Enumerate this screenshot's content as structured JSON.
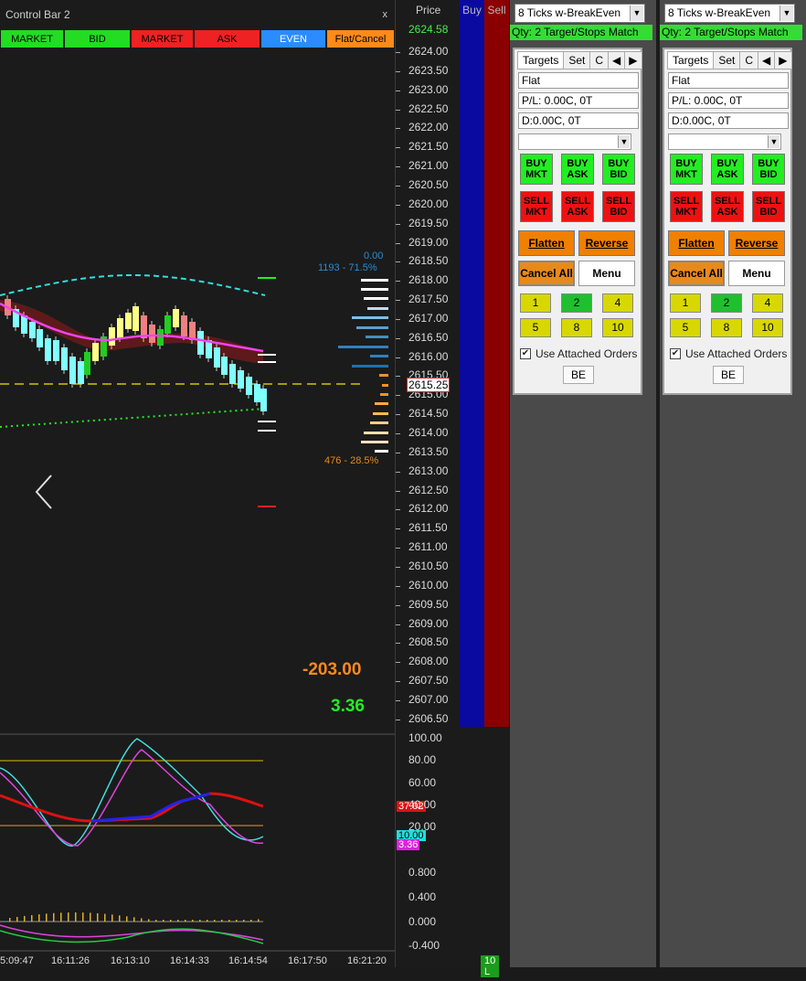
{
  "control_bar": {
    "title": "Control Bar 2",
    "close": "x",
    "buttons": [
      {
        "label": "MARKET",
        "color": "#22dd22",
        "text_color": "#000000"
      },
      {
        "label": "BID",
        "color": "#22dd22",
        "text_color": "#000000"
      },
      {
        "label": "MARKET",
        "color": "#ee2222",
        "text_color": "#000000"
      },
      {
        "label": "ASK",
        "color": "#ee2222",
        "text_color": "#000000"
      },
      {
        "label": "EVEN",
        "color": "#2a8cff",
        "text_color": "#ffffff"
      },
      {
        "label": "Flat/Cancel",
        "color": "#ff8a1a",
        "text_color": "#000000"
      }
    ]
  },
  "price_axis": {
    "header": "Price",
    "current_price_top": "2624.58",
    "last_price": "2615.25",
    "ticks": [
      "2624.00",
      "2623.50",
      "2623.00",
      "2622.50",
      "2622.00",
      "2621.50",
      "2621.00",
      "2620.50",
      "2620.00",
      "2619.50",
      "2619.00",
      "2618.50",
      "2618.00",
      "2617.50",
      "2617.00",
      "2616.50",
      "2616.00",
      "2615.50",
      "2615.00",
      "2614.50",
      "2614.00",
      "2613.50",
      "2613.00",
      "2612.50",
      "2612.00",
      "2611.50",
      "2611.00",
      "2610.50",
      "2610.00",
      "2609.50",
      "2609.00",
      "2608.50",
      "2608.00",
      "2607.50",
      "2607.00",
      "2606.50"
    ]
  },
  "oscillator_axis": {
    "ticks": [
      "100.00",
      "80.00",
      "60.00",
      "40.00",
      "20.00"
    ],
    "ticks2": [
      "0.800",
      "0.400",
      "0.000",
      "-0.400"
    ],
    "labels": [
      {
        "text": "37.02",
        "color": "#dd1111"
      },
      {
        "text": "10.00",
        "color": "#22dddd"
      },
      {
        "text": "3.36",
        "color": "#dd22dd"
      }
    ]
  },
  "chart_labels": {
    "top_value": "0.00",
    "top_volume": "1193 - 71.5%",
    "bottom_volume": "476 - 28.5%",
    "pnl": "-203.00",
    "value2": "3.36"
  },
  "time_axis": [
    "5:09:47",
    "16:11:26",
    "16:13:10",
    "16:14:33",
    "16:14:54",
    "16:17:50",
    "16:21:20"
  ],
  "columns": {
    "buy": "Buy",
    "sell": "Sell"
  },
  "status": {
    "bottom_badge": "10 L"
  },
  "panels": [
    {
      "atm": "8 Ticks w-BreakEven",
      "qty_bar": "Qty: 2 Target/Stops Match",
      "tabs": [
        "Targets",
        "Set",
        "C"
      ],
      "position": "Flat",
      "pl": "P/L: 0.00C, 0T",
      "daily": "D:0.00C, 0T",
      "buy_buttons": [
        [
          "BUY",
          "MKT"
        ],
        [
          "BUY",
          "ASK"
        ],
        [
          "BUY",
          "BID"
        ]
      ],
      "sell_buttons": [
        [
          "SELL",
          "MKT"
        ],
        [
          "SELL",
          "ASK"
        ],
        [
          "SELL",
          "BID"
        ]
      ],
      "flatten": "Flatten",
      "reverse": "Reverse",
      "cancel_all": "Cancel All",
      "menu": "Menu",
      "qty_buttons": [
        "1",
        "2",
        "4",
        "5",
        "8",
        "10"
      ],
      "selected_qty": "2",
      "use_attached": "Use Attached Orders",
      "be": "BE"
    },
    {
      "atm": "8 Ticks w-BreakEven",
      "qty_bar": "Qty: 2 Target/Stops Match",
      "tabs": [
        "Targets",
        "Set",
        "C"
      ],
      "position": "Flat",
      "pl": "P/L: 0.00C, 0T",
      "daily": "D:0.00C, 0T",
      "buy_buttons": [
        [
          "BUY",
          "MKT"
        ],
        [
          "BUY",
          "ASK"
        ],
        [
          "BUY",
          "BID"
        ]
      ],
      "sell_buttons": [
        [
          "SELL",
          "MKT"
        ],
        [
          "SELL",
          "ASK"
        ],
        [
          "SELL",
          "BID"
        ]
      ],
      "flatten": "Flatten",
      "reverse": "Reverse",
      "cancel_all": "Cancel All",
      "menu": "Menu",
      "qty_buttons": [
        "1",
        "2",
        "4",
        "5",
        "8",
        "10"
      ],
      "selected_qty": "2",
      "use_attached": "Use Attached Orders",
      "be": "BE"
    }
  ]
}
